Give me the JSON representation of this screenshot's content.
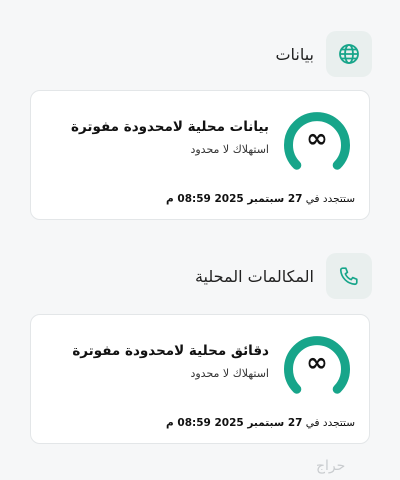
{
  "sections": [
    {
      "title": "بيانات",
      "icon": "globe-icon",
      "card": {
        "title": "بيانات محلية لامحدودة مفوترة",
        "subtitle": "استهلاك لا محدود",
        "renew_prefix": "ستتجدد في",
        "renew_date": "27 سبتمبر 2025 08:59 م",
        "gauge_symbol": "∞"
      }
    },
    {
      "title": "المكالمات المحلية",
      "icon": "phone-icon",
      "card": {
        "title": "دقائق محلية لامحدودة مفوترة",
        "subtitle": "استهلاك لا محدود",
        "renew_prefix": "ستتجدد في",
        "renew_date": "27 سبتمبر 2025 08:59 م",
        "gauge_symbol": "∞"
      }
    }
  ],
  "colors": {
    "accent": "#17a58a",
    "icon_bg": "#e9efee",
    "card_bg": "#ffffff",
    "page_bg": "#f6f7f8"
  },
  "watermark": "حراج"
}
